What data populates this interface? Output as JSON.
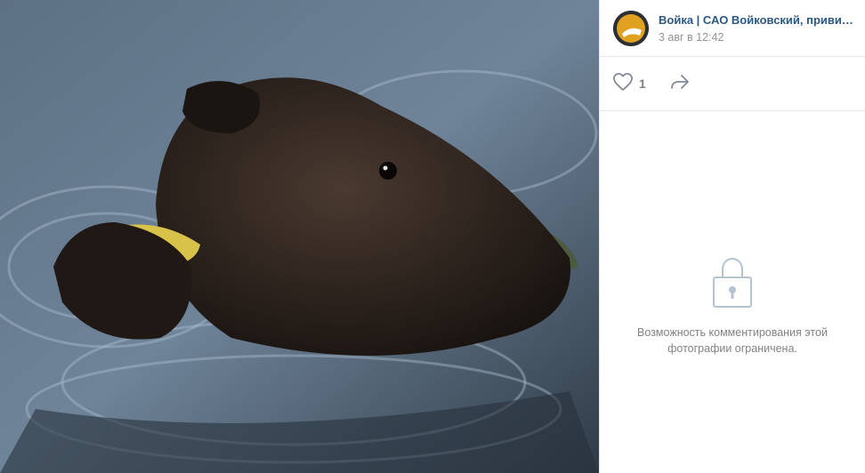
{
  "post": {
    "author_name": "Войка | САО Войковский, привива…",
    "date": "3 авг в 12:42",
    "likes_count": "1"
  },
  "comments": {
    "locked_message": "Возможность комментирования этой фотографии ограничена."
  },
  "icons": {
    "avatar": "community-avatar",
    "like": "heart-icon",
    "share": "share-arrow-icon",
    "lock": "lock-icon"
  },
  "colors": {
    "link": "#2a5885",
    "muted": "#828282",
    "divider": "#e7e8ec"
  }
}
